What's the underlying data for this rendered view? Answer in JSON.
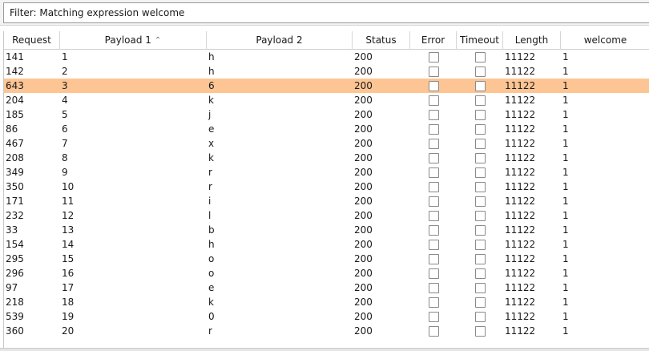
{
  "filter": {
    "text": "Filter: Matching expression welcome"
  },
  "table": {
    "columns": [
      {
        "key": "request",
        "label": "Request"
      },
      {
        "key": "payload1",
        "label": "Payload 1"
      },
      {
        "key": "payload2",
        "label": "Payload 2"
      },
      {
        "key": "status",
        "label": "Status"
      },
      {
        "key": "error",
        "label": "Error"
      },
      {
        "key": "timeout",
        "label": "Timeout"
      },
      {
        "key": "length",
        "label": "Length"
      },
      {
        "key": "welcome",
        "label": "welcome"
      }
    ],
    "sort": {
      "column": "payload1",
      "direction": "ascending",
      "icon": "chevron-up-icon"
    },
    "selected_index": 2,
    "selected_color": "#fdc594",
    "rows": [
      {
        "request": "141",
        "payload1": "1",
        "payload2": "h",
        "status": "200",
        "error": false,
        "timeout": false,
        "length": "11122",
        "welcome": "1"
      },
      {
        "request": "142",
        "payload1": "2",
        "payload2": "h",
        "status": "200",
        "error": false,
        "timeout": false,
        "length": "11122",
        "welcome": "1"
      },
      {
        "request": "643",
        "payload1": "3",
        "payload2": "6",
        "status": "200",
        "error": false,
        "timeout": false,
        "length": "11122",
        "welcome": "1"
      },
      {
        "request": "204",
        "payload1": "4",
        "payload2": "k",
        "status": "200",
        "error": false,
        "timeout": false,
        "length": "11122",
        "welcome": "1"
      },
      {
        "request": "185",
        "payload1": "5",
        "payload2": "j",
        "status": "200",
        "error": false,
        "timeout": false,
        "length": "11122",
        "welcome": "1"
      },
      {
        "request": "86",
        "payload1": "6",
        "payload2": "e",
        "status": "200",
        "error": false,
        "timeout": false,
        "length": "11122",
        "welcome": "1"
      },
      {
        "request": "467",
        "payload1": "7",
        "payload2": "x",
        "status": "200",
        "error": false,
        "timeout": false,
        "length": "11122",
        "welcome": "1"
      },
      {
        "request": "208",
        "payload1": "8",
        "payload2": "k",
        "status": "200",
        "error": false,
        "timeout": false,
        "length": "11122",
        "welcome": "1"
      },
      {
        "request": "349",
        "payload1": "9",
        "payload2": "r",
        "status": "200",
        "error": false,
        "timeout": false,
        "length": "11122",
        "welcome": "1"
      },
      {
        "request": "350",
        "payload1": "10",
        "payload2": "r",
        "status": "200",
        "error": false,
        "timeout": false,
        "length": "11122",
        "welcome": "1"
      },
      {
        "request": "171",
        "payload1": "11",
        "payload2": "i",
        "status": "200",
        "error": false,
        "timeout": false,
        "length": "11122",
        "welcome": "1"
      },
      {
        "request": "232",
        "payload1": "12",
        "payload2": "l",
        "status": "200",
        "error": false,
        "timeout": false,
        "length": "11122",
        "welcome": "1"
      },
      {
        "request": "33",
        "payload1": "13",
        "payload2": "b",
        "status": "200",
        "error": false,
        "timeout": false,
        "length": "11122",
        "welcome": "1"
      },
      {
        "request": "154",
        "payload1": "14",
        "payload2": "h",
        "status": "200",
        "error": false,
        "timeout": false,
        "length": "11122",
        "welcome": "1"
      },
      {
        "request": "295",
        "payload1": "15",
        "payload2": "o",
        "status": "200",
        "error": false,
        "timeout": false,
        "length": "11122",
        "welcome": "1"
      },
      {
        "request": "296",
        "payload1": "16",
        "payload2": "o",
        "status": "200",
        "error": false,
        "timeout": false,
        "length": "11122",
        "welcome": "1"
      },
      {
        "request": "97",
        "payload1": "17",
        "payload2": "e",
        "status": "200",
        "error": false,
        "timeout": false,
        "length": "11122",
        "welcome": "1"
      },
      {
        "request": "218",
        "payload1": "18",
        "payload2": "k",
        "status": "200",
        "error": false,
        "timeout": false,
        "length": "11122",
        "welcome": "1"
      },
      {
        "request": "539",
        "payload1": "19",
        "payload2": "0",
        "status": "200",
        "error": false,
        "timeout": false,
        "length": "11122",
        "welcome": "1"
      },
      {
        "request": "360",
        "payload1": "20",
        "payload2": "r",
        "status": "200",
        "error": false,
        "timeout": false,
        "length": "11122",
        "welcome": "1"
      }
    ]
  }
}
